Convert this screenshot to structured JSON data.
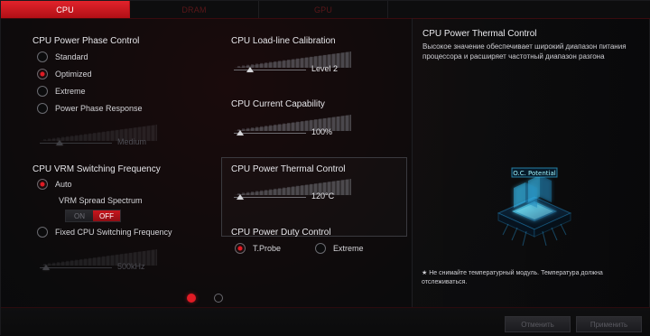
{
  "tabs": [
    {
      "label": "CPU"
    },
    {
      "label": "DRAM"
    },
    {
      "label": "GPU"
    }
  ],
  "left": {
    "phase_control": {
      "title": "CPU Power Phase Control",
      "options": [
        "Standard",
        "Optimized",
        "Extreme",
        "Power Phase Response"
      ],
      "selected_index": 1,
      "response_value": "Medium",
      "response_level": 0.2
    },
    "vrm_switching": {
      "title": "CPU VRM Switching Frequency",
      "auto_label": "Auto",
      "spread_label": "VRM Spread Spectrum",
      "spread_toggle": {
        "on_label": "ON",
        "off_label": "OFF",
        "state": "OFF"
      },
      "fixed_label": "Fixed CPU Switching Frequency",
      "fixed_value": "500kHz",
      "fixed_level": 0.0
    },
    "load_line": {
      "title": "CPU Load-line Calibration",
      "value": "Level 2",
      "level": 0.15
    },
    "current_capability": {
      "title": "CPU Current Capability",
      "value": "100%",
      "level": 0.0
    },
    "thermal_control": {
      "title": "CPU Power Thermal Control",
      "value": "120°C",
      "level": 0.0
    },
    "duty_control": {
      "title": "CPU Power Duty Control",
      "options": [
        "T.Probe",
        "Extreme"
      ],
      "selected_index": 0
    },
    "pager": {
      "pages": 2,
      "active": 0
    }
  },
  "right": {
    "title": "CPU Power Thermal Control",
    "description": "Высокое значение обеспечивает широкий диапазон питания процессора и расширяет частотный диапазон разгона",
    "image_caption": "O.C. Potential",
    "note": "★ Не снимайте температурный модуль. Температура должна отслеживаться."
  },
  "buttons": {
    "cancel": "Отменить",
    "apply": "Применить"
  },
  "colors": {
    "accent_red": "#e01b24",
    "background": "#0b0b0c",
    "panel_border": "#3a3a3f"
  },
  "icons": {
    "chip_graphic": "cpu-chip-illustration",
    "slider_thumb": "triangle-thumb-icon"
  }
}
